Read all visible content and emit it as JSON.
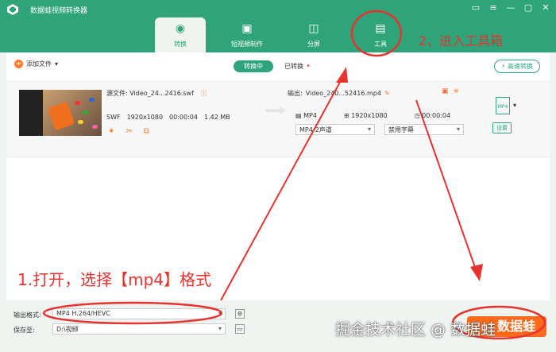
{
  "window": {
    "title": "数据蛙视频转换器"
  },
  "tabs": [
    {
      "label": "转换",
      "icon": "convert-icon"
    },
    {
      "label": "短视频制作",
      "icon": "short-video-icon"
    },
    {
      "label": "分屏",
      "icon": "split-screen-icon"
    },
    {
      "label": "工具",
      "icon": "toolbox-icon"
    }
  ],
  "toolbar": {
    "add_files": "添加文件",
    "converting": "转换中",
    "converted": "已转换",
    "high_speed": "高速转换"
  },
  "item": {
    "source_label": "源文件:",
    "source_name": "Video_24...2416.swf",
    "source_format": "SWF",
    "source_resolution": "1920x1080",
    "source_duration": "00:00:04",
    "source_size": "1.42 MB",
    "output_label": "输出:",
    "output_name": "Video_240...52416.mp4",
    "output_format": "MP4",
    "output_resolution": "1920x1080",
    "output_duration": "00:00:04",
    "audio_select": "MP4-2声道",
    "subtitle_select": "禁用字幕",
    "settings": "设置",
    "format_badge": "MP4"
  },
  "bottom": {
    "output_format_label": "输出格式:",
    "output_format_value": "MP4 H.264/HEVC",
    "save_to_label": "保存至:",
    "save_to_value": "D:\\视频",
    "convert_button": "数据蛙"
  },
  "annotations": {
    "step1": "1.打开，选择【mp4】格式",
    "step2": "2、进入工具箱",
    "watermark": "掘金技术社区 @ 数据蛙"
  },
  "colors": {
    "brand": "#2fa47a",
    "accent": "#ff6a1a",
    "annotation": "#e8322e"
  }
}
